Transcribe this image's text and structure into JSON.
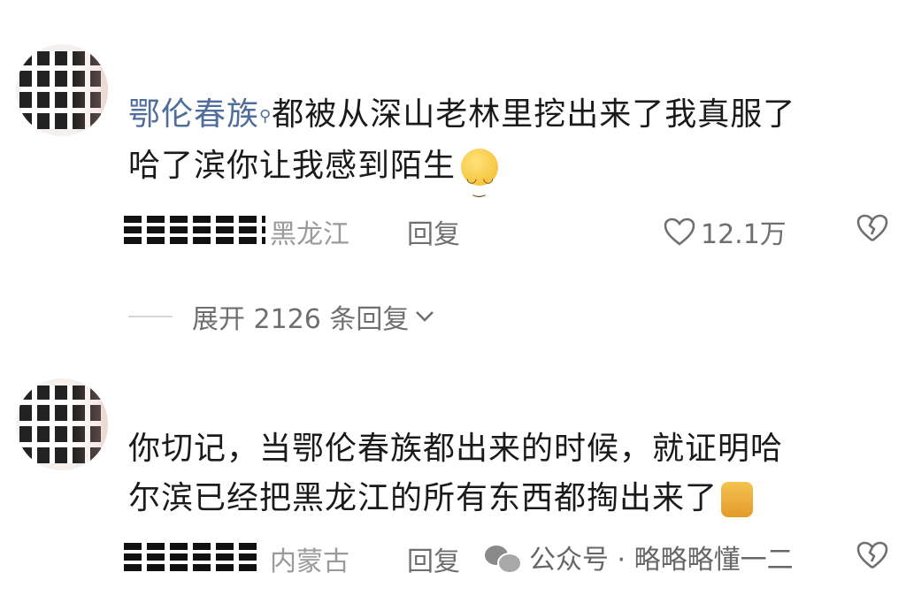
{
  "comments": [
    {
      "username": "鄂伦春族",
      "text_line1": "都被从深山老林里挖出来了我真服了",
      "text_line2": "哈了滨你让我感到陌生",
      "emoji": "smiling-face",
      "location": "黑龙江",
      "reply_label": "回复",
      "likes": "12.1万"
    },
    {
      "text_line1": "你切记，当鄂伦春族都出来的时候，就证明哈",
      "text_line2": "尔滨已经把黑龙江的所有东西都掏出来了",
      "emoji": "cat-face",
      "location": "内蒙古",
      "reply_label": "回复"
    }
  ],
  "expand_replies": {
    "label": "展开 2126 条回复",
    "icon": "chevron-down-icon"
  },
  "watermark": {
    "text": "公众号 · 略略略懂一二",
    "icon": "wechat-icon"
  },
  "colors": {
    "username": "#4f6e9c",
    "meta": "#9a9a9a",
    "body": "#1a1a1a"
  }
}
